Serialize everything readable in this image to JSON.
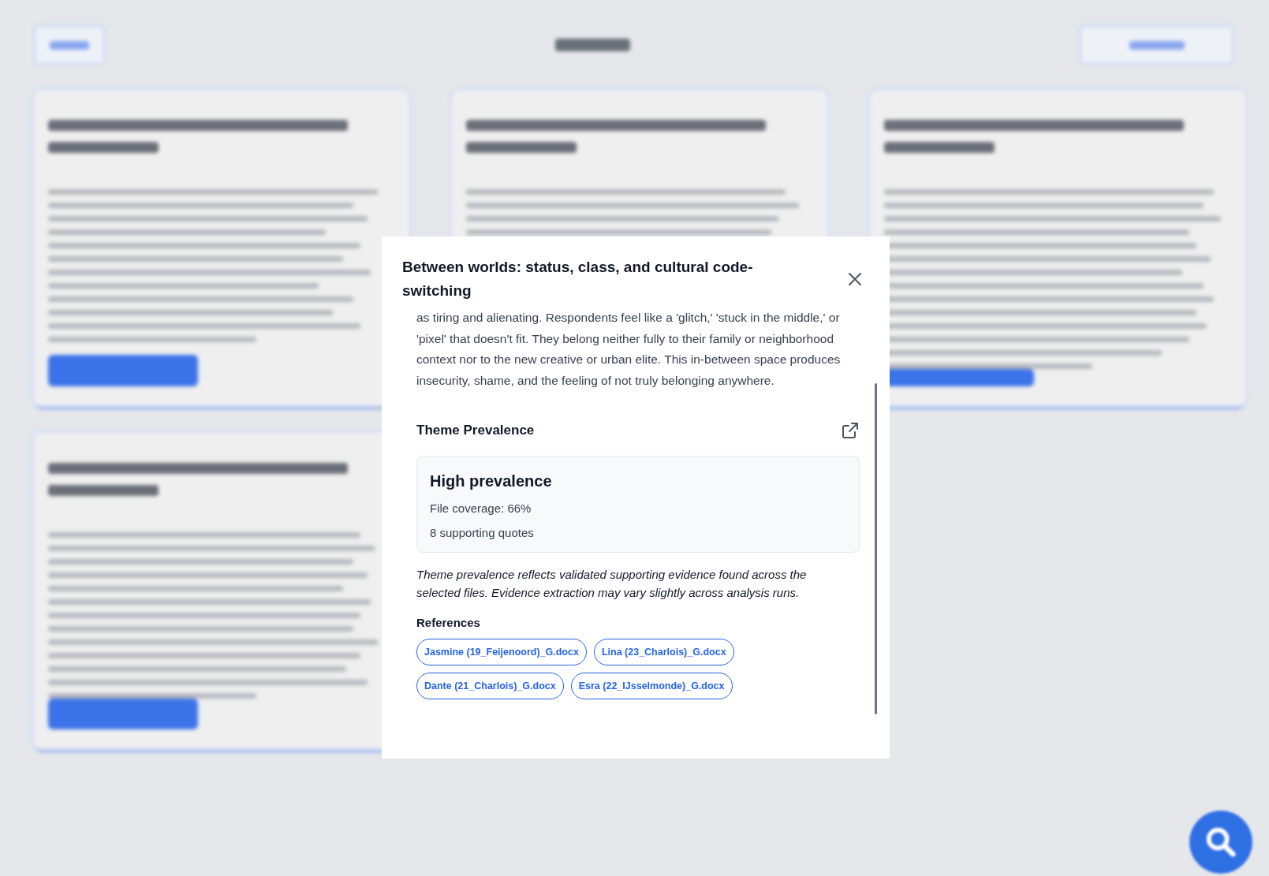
{
  "modal": {
    "title": "Between worlds: status, class, and cultural code-switching",
    "description": "as tiring and alienating. Respondents feel like a 'glitch,' 'stuck in the middle,' or 'pixel' that doesn't fit. They belong neither fully to their family or neighborhood context nor to the new creative or urban elite. This in-between space produces insecurity, shame, and the feeling of not truly belonging anywhere.",
    "prevalence_heading": "Theme Prevalence",
    "prevalence": {
      "level_label": "High prevalence",
      "file_coverage": "File coverage: 66%",
      "quotes": "8 supporting quotes"
    },
    "note": "Theme prevalence reflects validated supporting evidence found across the selected files. Evidence extraction may vary slightly across analysis runs.",
    "references_heading": "References",
    "references": [
      "Jasmine (19_Feijenoord)_G.docx",
      "Lina (23_Charlois)_G.docx",
      "Dante (21_Charlois)_G.docx",
      "Esra (22_IJsselmonde)_G.docx"
    ]
  }
}
